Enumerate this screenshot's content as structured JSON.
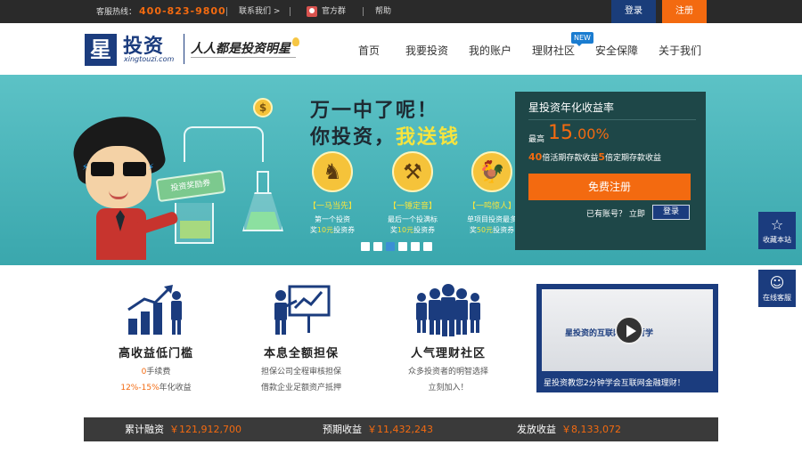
{
  "topbar": {
    "hotline_label": "客服热线：",
    "hotline_number": "400-823-9800",
    "contact": "联系我们 >",
    "official_group": "官方群",
    "help": "帮助",
    "login": "登录",
    "register": "注册"
  },
  "header": {
    "logo_mark": "星",
    "logo_text": "投资",
    "logo_url_text": "xingtouzi.com",
    "slogan": "人人都是投资明星"
  },
  "nav": {
    "items": [
      {
        "label": "首页"
      },
      {
        "label": "我要投资"
      },
      {
        "label": "我的账户"
      },
      {
        "label": "理财社区"
      },
      {
        "label": "安全保障"
      },
      {
        "label": "关于我们"
      }
    ],
    "new_badge": "NEW"
  },
  "banner": {
    "headline_line1": "万一中了呢！",
    "headline_line2_prefix": "你投资，",
    "headline_line2_highlight": "我送钱",
    "voucher_label": "投资奖励券",
    "coin_symbol": "$",
    "promos": [
      {
        "title": "【一马当先】",
        "desc1": "第一个投资",
        "desc2_prefix": "奖",
        "amount": "10元",
        "desc2_suffix": "投资券"
      },
      {
        "title": "【一锤定音】",
        "desc1": "最后一个投满标",
        "desc2_prefix": "奖",
        "amount": "10元",
        "desc2_suffix": "投资券"
      },
      {
        "title": "【一鸣惊人】",
        "desc1": "单项目投资最多",
        "desc2_prefix": "奖",
        "amount": "50元",
        "desc2_suffix": "投资券"
      }
    ],
    "active_slide": 3,
    "slide_count": 6
  },
  "yield_panel": {
    "title": "星投资年化收益率",
    "rate_label": "最高",
    "rate_int": "15",
    "rate_dec": ".00%",
    "multiple1": "40",
    "desc1": "倍活期存款收益",
    "multiple2": "5",
    "desc2": "倍定期存款收益",
    "cta": "免费注册",
    "have_account": "已有账号？ 立即",
    "login": "登录"
  },
  "side": {
    "bookmark": "收藏本站",
    "service": "在线客服"
  },
  "features": [
    {
      "title": "高收益低门槛",
      "line1_hl": "0",
      "line1_rest": "手续费",
      "line2_hl": "12%-15%",
      "line2_rest": "年化收益"
    },
    {
      "title": "本息全额担保",
      "line1": "担保公司全程审核担保",
      "line2": "借款企业足额资产抵押"
    },
    {
      "title": "人气理财社区",
      "line1": "众多投资者的明智选择",
      "line2": "立刻加入！"
    }
  ],
  "video": {
    "caption": "星投资的互联网投资哲学",
    "title": "星投资教您2分钟学会互联网金融理财！"
  },
  "stats": [
    {
      "label": "累计融资",
      "value": "￥121,912,700"
    },
    {
      "label": "预期收益",
      "value": "￥11,432,243"
    },
    {
      "label": "发放收益",
      "value": "￥8,133,072"
    }
  ],
  "colors": {
    "brand_blue": "#1b3c7e",
    "accent_orange": "#f36a10",
    "banner_teal": "#3aa7ad",
    "panel_dark": "#1e4748"
  }
}
